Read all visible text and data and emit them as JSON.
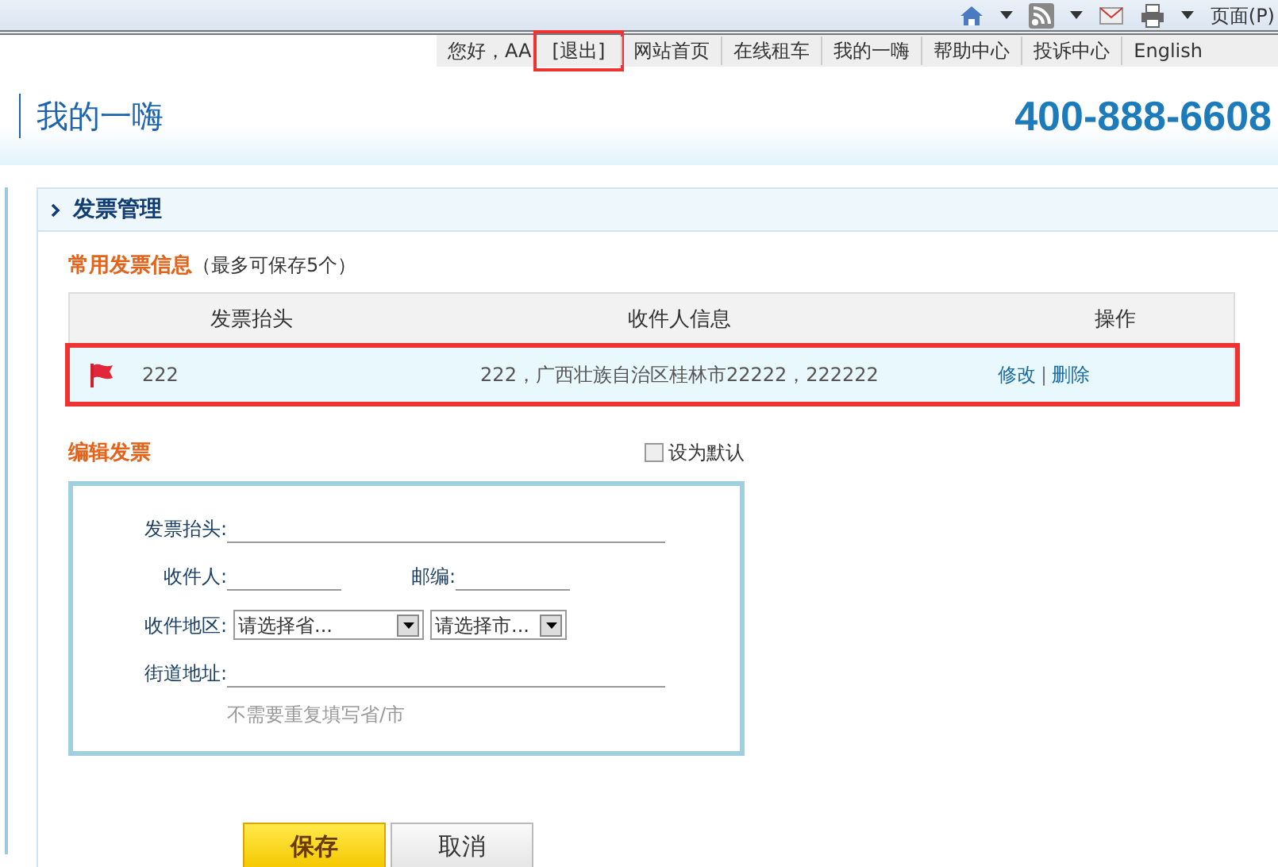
{
  "browser_toolbar": {
    "page_menu": "页面(P)"
  },
  "top_links": [
    {
      "label": "您好，AA",
      "highlighted": false
    },
    {
      "label": "[退出]",
      "highlighted": true
    },
    {
      "label": "网站首页",
      "highlighted": false
    },
    {
      "label": "在线租车",
      "highlighted": false
    },
    {
      "label": "我的一嗨",
      "highlighted": false
    },
    {
      "label": "帮助中心",
      "highlighted": false
    },
    {
      "label": "投诉中心",
      "highlighted": false
    },
    {
      "label": "English",
      "highlighted": false
    }
  ],
  "header": {
    "title": "我的一嗨",
    "phone": "400-888-6608"
  },
  "panel": {
    "title": "发票管理",
    "section_title": "常用发票信息",
    "section_note": "（最多可保存5个）",
    "table": {
      "columns": [
        "发票抬头",
        "收件人信息",
        "操作"
      ],
      "rows": [
        {
          "flagged": true,
          "highlighted": true,
          "title": "222",
          "recipient": "222，广西壮族自治区桂林市22222，222222",
          "actions": [
            "修改",
            "删除"
          ],
          "action_separator": "|"
        }
      ]
    },
    "edit": {
      "title": "编辑发票",
      "default_checkbox": {
        "label": "设为默认",
        "checked": false
      },
      "fields": [
        {
          "label": "发票抬头:",
          "kind": "text"
        },
        {
          "label": "收件人:",
          "kind": "pair",
          "second_label": "邮编:"
        },
        {
          "label": "收件地区:",
          "kind": "selects",
          "options": [
            "请选择省...",
            "请选择市..."
          ]
        },
        {
          "label": "街道地址:",
          "kind": "text",
          "hint": "不需要重复填写省/市"
        }
      ],
      "buttons": [
        {
          "label": "保存",
          "kind": "primary"
        },
        {
          "label": "取消",
          "kind": "secondary"
        }
      ]
    }
  }
}
